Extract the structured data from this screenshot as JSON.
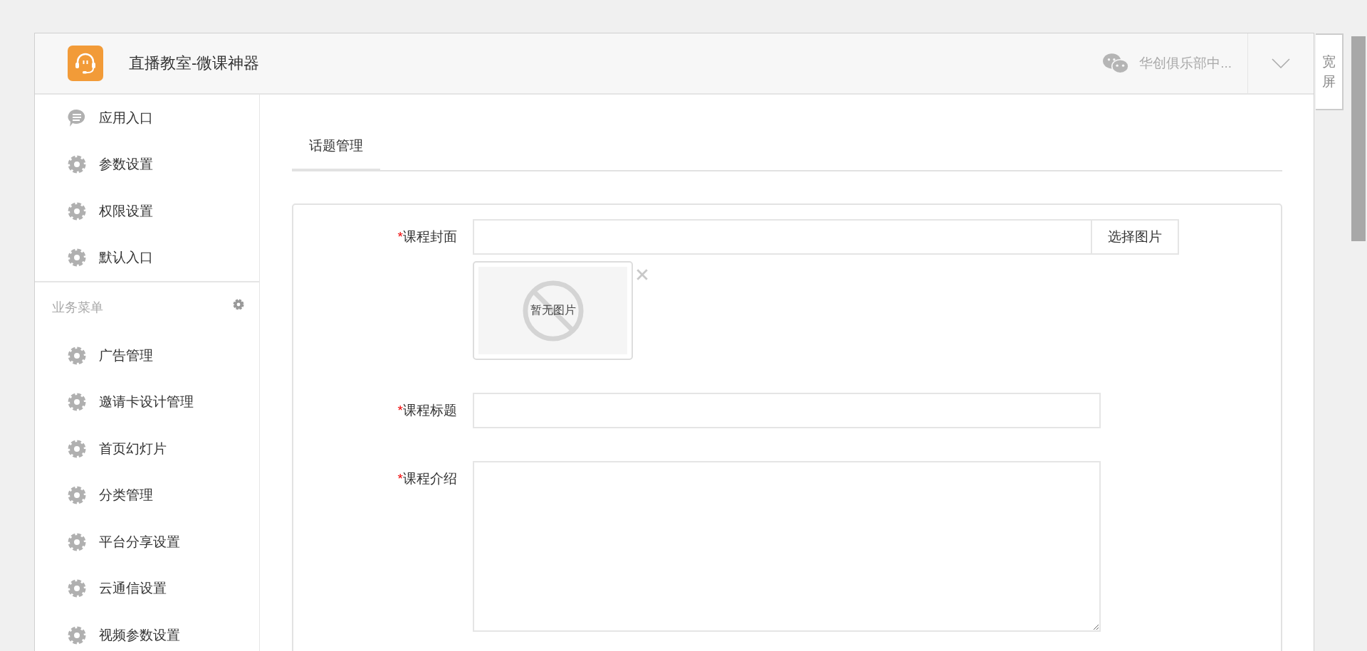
{
  "header": {
    "title": "直播教室-微课神器",
    "account": "华创俱乐部中..."
  },
  "wide_button": {
    "label": "宽屏"
  },
  "sidebar": {
    "top_items": [
      {
        "label": "应用入口"
      },
      {
        "label": "参数设置"
      },
      {
        "label": "权限设置"
      },
      {
        "label": "默认入口"
      }
    ],
    "section": {
      "title": "业务菜单"
    },
    "items": [
      {
        "label": "广告管理"
      },
      {
        "label": "邀请卡设计管理"
      },
      {
        "label": "首页幻灯片"
      },
      {
        "label": "分类管理"
      },
      {
        "label": "平台分享设置"
      },
      {
        "label": "云通信设置"
      },
      {
        "label": "视频参数设置"
      }
    ]
  },
  "tabs": [
    {
      "label": "话题管理",
      "selected": true
    }
  ],
  "form": [
    {
      "kind": "image",
      "mark": "*",
      "label": "课程封面",
      "button": "选择图片",
      "preview": "暂无图片"
    },
    {
      "kind": "text",
      "mark": "*",
      "label": "课程标题"
    },
    {
      "kind": "textarea",
      "mark": "*",
      "label": "课程介绍"
    }
  ]
}
